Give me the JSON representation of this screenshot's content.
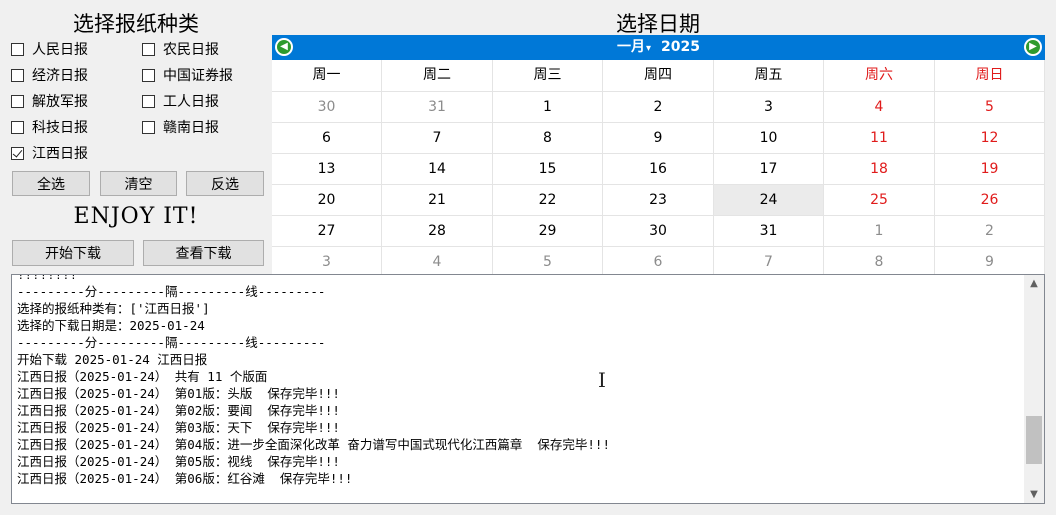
{
  "left": {
    "title": "选择报纸种类",
    "newspapers": [
      {
        "label": "人民日报",
        "checked": false
      },
      {
        "label": "农民日报",
        "checked": false
      },
      {
        "label": "经济日报",
        "checked": false
      },
      {
        "label": "中国证券报",
        "checked": false
      },
      {
        "label": "解放军报",
        "checked": false
      },
      {
        "label": "工人日报",
        "checked": false
      },
      {
        "label": "科技日报",
        "checked": false
      },
      {
        "label": "赣南日报",
        "checked": false
      },
      {
        "label": "江西日报",
        "checked": true
      }
    ],
    "select_all": "全选",
    "clear": "清空",
    "invert": "反选",
    "enjoy": "ENJOY IT!",
    "start_download": "开始下载",
    "view_downloads": "查看下载"
  },
  "calendar": {
    "title": "选择日期",
    "month": "一月",
    "year": "2025",
    "prev_icon": "green-left-arrow-icon",
    "next_icon": "green-right-arrow-icon",
    "header_color": "#0078d7",
    "weekend_color": "#e01b1b",
    "weekdays": [
      "周一",
      "周二",
      "周三",
      "周四",
      "周五",
      "周六",
      "周日"
    ],
    "weeks": [
      [
        {
          "d": "30",
          "other": true
        },
        {
          "d": "31",
          "other": true
        },
        {
          "d": "1"
        },
        {
          "d": "2"
        },
        {
          "d": "3"
        },
        {
          "d": "4"
        },
        {
          "d": "5"
        }
      ],
      [
        {
          "d": "6"
        },
        {
          "d": "7"
        },
        {
          "d": "8"
        },
        {
          "d": "9"
        },
        {
          "d": "10"
        },
        {
          "d": "11"
        },
        {
          "d": "12"
        }
      ],
      [
        {
          "d": "13"
        },
        {
          "d": "14"
        },
        {
          "d": "15"
        },
        {
          "d": "16"
        },
        {
          "d": "17"
        },
        {
          "d": "18"
        },
        {
          "d": "19"
        }
      ],
      [
        {
          "d": "20"
        },
        {
          "d": "21"
        },
        {
          "d": "22"
        },
        {
          "d": "23"
        },
        {
          "d": "24",
          "selected": true
        },
        {
          "d": "25"
        },
        {
          "d": "26"
        }
      ],
      [
        {
          "d": "27"
        },
        {
          "d": "28"
        },
        {
          "d": "29"
        },
        {
          "d": "30"
        },
        {
          "d": "31"
        },
        {
          "d": "1",
          "other": true
        },
        {
          "d": "2",
          "other": true
        }
      ],
      [
        {
          "d": "3",
          "other": true
        },
        {
          "d": "4",
          "other": true
        },
        {
          "d": "5",
          "other": true
        },
        {
          "d": "6",
          "other": true
        },
        {
          "d": "7",
          "other": true
        },
        {
          "d": "8",
          "other": true
        },
        {
          "d": "9",
          "other": true
        }
      ]
    ]
  },
  "log": {
    "lines": [
      "!!!!!!!!",
      "---------分---------隔---------线---------",
      "选择的报纸种类有：['江西日报']",
      "选择的下载日期是：2025-01-24",
      "---------分---------隔---------线---------",
      "开始下载 2025-01-24 江西日报",
      "江西日报（2025-01-24） 共有 11 个版面",
      "江西日报（2025-01-24） 第01版：头版  保存完毕!!!",
      "江西日报（2025-01-24） 第02版：要闻  保存完毕!!!",
      "江西日报（2025-01-24） 第03版：天下  保存完毕!!!",
      "江西日报（2025-01-24） 第04版：进一步全面深化改革 奋力谱写中国式现代化江西篇章  保存完毕!!!",
      "江西日报（2025-01-24） 第05版：视线  保存完毕!!!",
      "江西日报（2025-01-24） 第06版：红谷滩  保存完毕!!!"
    ],
    "scroll_position": 0.85
  }
}
